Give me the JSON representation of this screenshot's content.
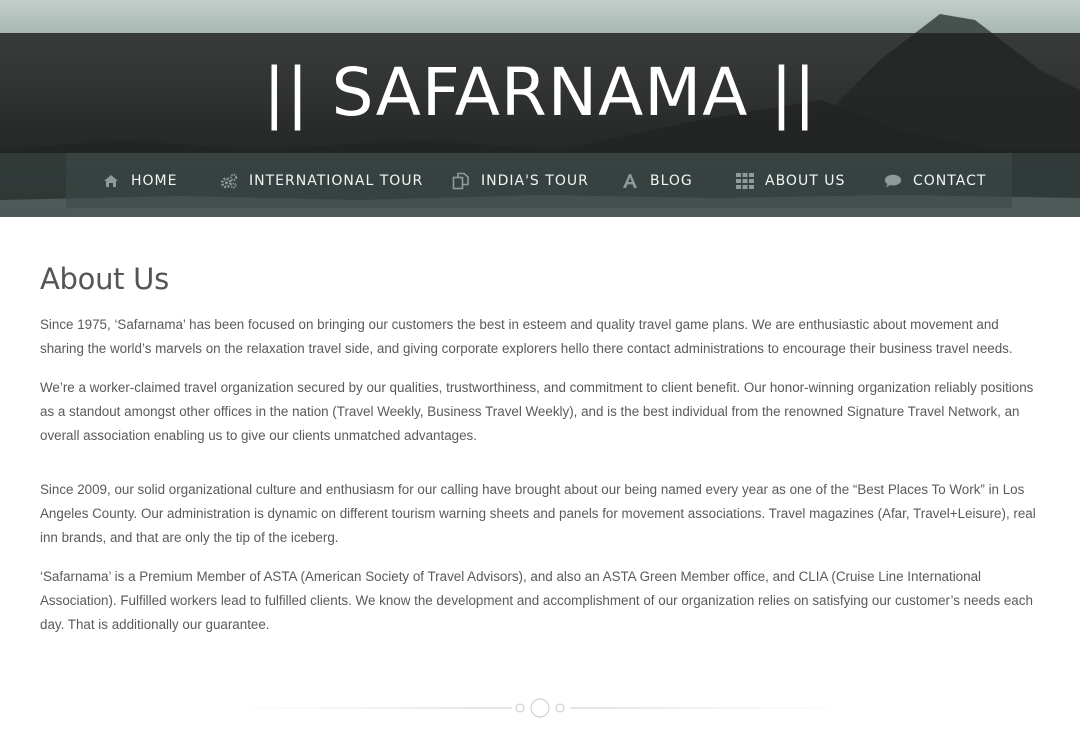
{
  "header": {
    "site_title": "|| SAFARNAMA ||"
  },
  "nav": {
    "items": [
      {
        "label": "HOME",
        "icon": "home-icon"
      },
      {
        "label": "INTERNATIONAL TOUR",
        "icon": "gears-icon"
      },
      {
        "label": "INDIA'S TOUR",
        "icon": "copy-icon"
      },
      {
        "label": "BLOG",
        "icon": "font-icon"
      },
      {
        "label": "ABOUT US",
        "icon": "grid-icon"
      },
      {
        "label": "CONTACT",
        "icon": "chat-bubble-icon"
      }
    ]
  },
  "main": {
    "title": "About Us",
    "paragraphs": [
      "Since 1975, ‘Safarnama’ has been focused on bringing our customers the best in esteem and quality travel game plans. We are enthusiastic about movement and sharing the world’s marvels on the relaxation travel side, and giving corporate explorers hello there contact administrations to encourage their business travel needs.",
      "We’re a worker-claimed travel organization secured by our qualities, trustworthiness, and commitment to client benefit. Our honor-winning organization reliably positions as a standout amongst other offices in the nation (Travel Weekly, Business Travel Weekly), and is the best individual from the renowned Signature Travel Network, an overall association enabling us to give our clients unmatched advantages.",
      "Since 2009, our solid organizational culture and enthusiasm for our calling have brought about our being named every year as one of the “Best Places To Work” in Los Angeles County. Our administration is dynamic on different tourism warning sheets and panels for movement associations. Travel magazines (Afar, Travel+Leisure), real inn brands, and that are only the tip of the iceberg.",
      "‘Safarnama’ is a Premium Member of ASTA (American Society of Travel Advisors), and also an ASTA Green Member office, and CLIA (Cruise Line International Association). Fulfilled workers lead to fulfilled clients. We know the development and accomplishment of our organization relies on satisfying our customer’s needs each day. That is additionally our guarantee."
    ]
  },
  "colors": {
    "title_band": "#202020",
    "nav_text": "#f4f4f4",
    "body_text": "#5a5a5a",
    "divider": "#cfcfcf"
  }
}
